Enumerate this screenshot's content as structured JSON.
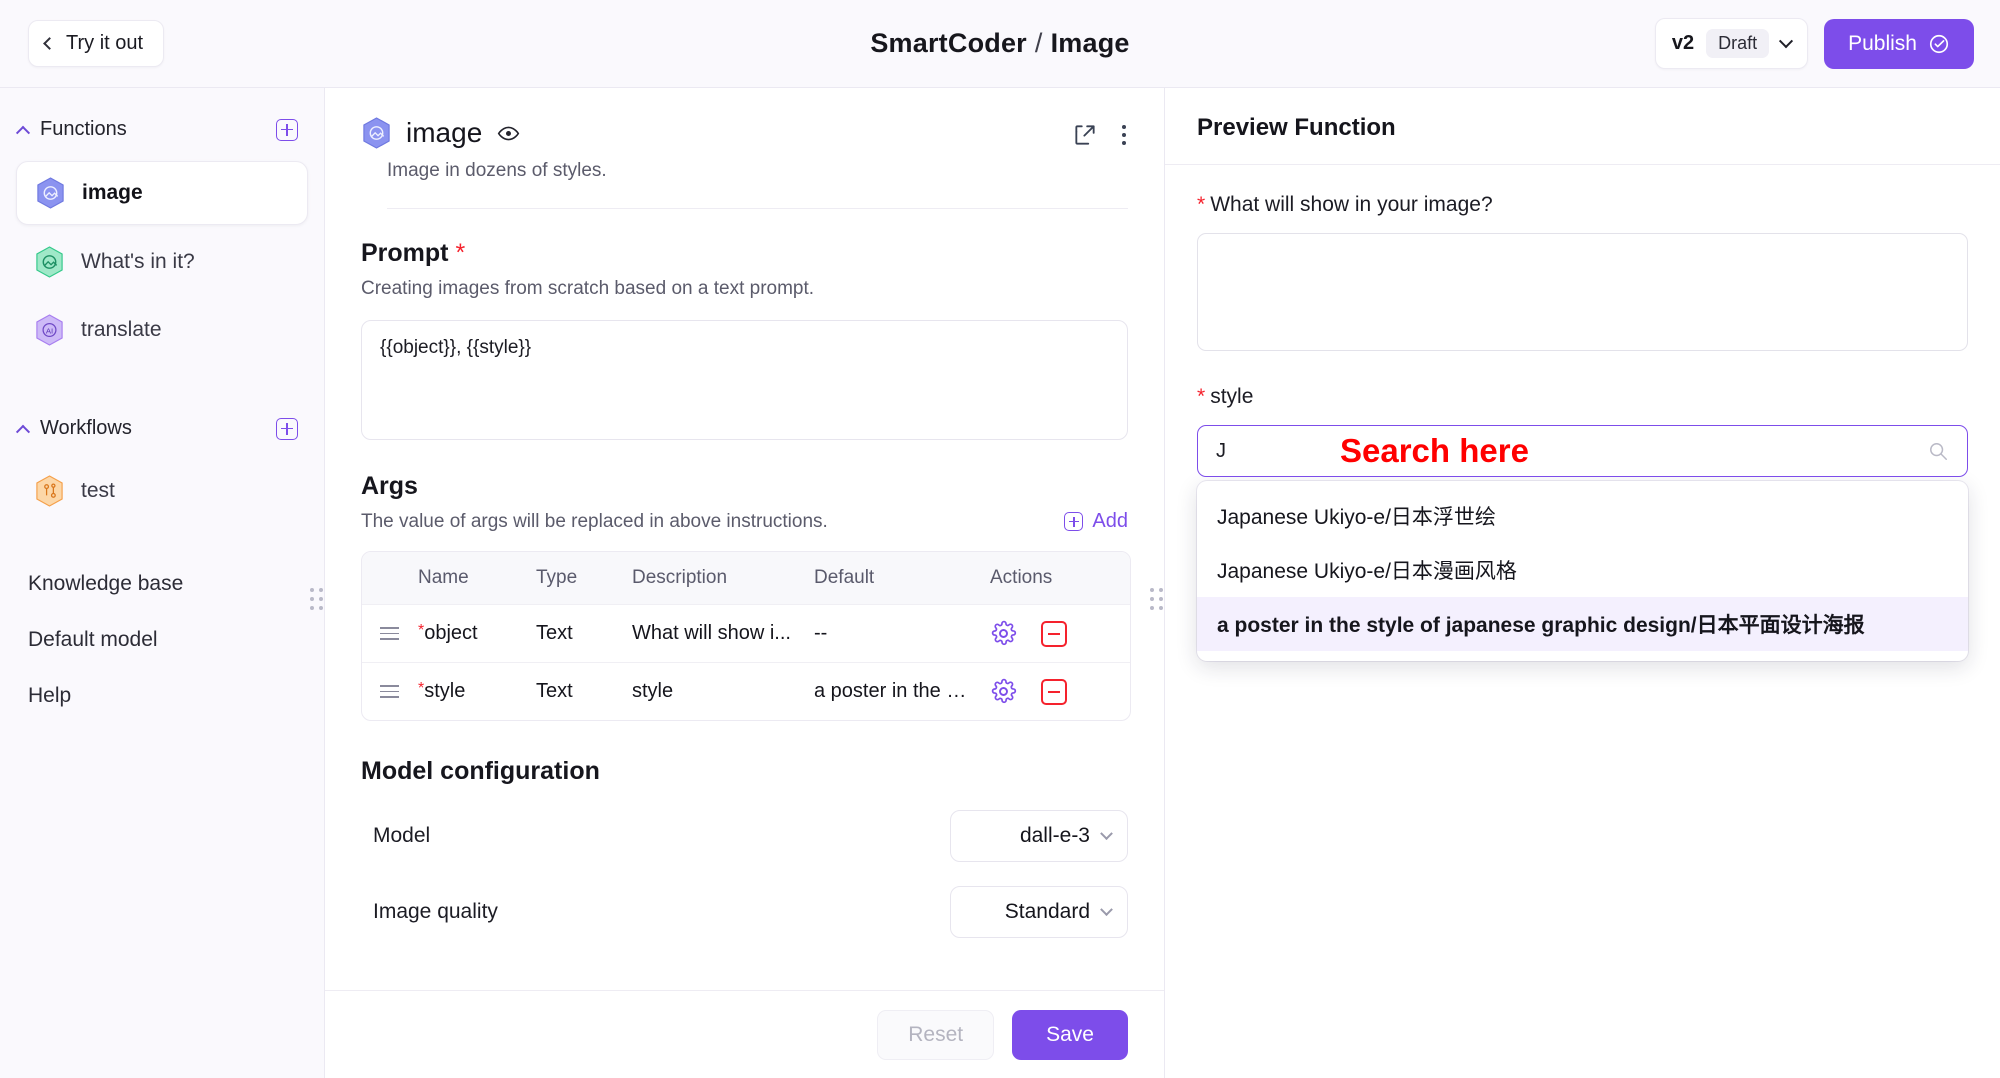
{
  "topbar": {
    "back_label": "Try it out",
    "back_icon": "chevron-left-icon",
    "app_name": "SmartCoder",
    "separator": "/",
    "page_name": "Image",
    "version": "v2",
    "version_status": "Draft",
    "version_caret_icon": "chevron-down-icon",
    "publish_label": "Publish",
    "publish_icon": "check-circle-icon",
    "accent_color": "#7d4dea"
  },
  "sidebar": {
    "sections": [
      {
        "label": "Functions",
        "collapse_icon": "chevron-up-icon",
        "add_icon": "plus-square-icon",
        "items": [
          {
            "label": "image",
            "icon": "hexagon-image-icon",
            "icon_color": "#6f7fe8",
            "active": true
          },
          {
            "label": "What's in it?",
            "icon": "hexagon-image-icon",
            "icon_color": "#34c98a",
            "active": false
          },
          {
            "label": "translate",
            "icon": "hexagon-ai-icon",
            "icon_color": "#a87ef0",
            "active": false
          }
        ]
      },
      {
        "label": "Workflows",
        "collapse_icon": "chevron-up-icon",
        "add_icon": "plus-square-icon",
        "items": [
          {
            "label": "test",
            "icon": "hexagon-workflow-icon",
            "icon_color": "#f5a04a",
            "active": false
          }
        ]
      }
    ],
    "links": [
      {
        "label": "Knowledge base"
      },
      {
        "label": "Default model"
      },
      {
        "label": "Help"
      }
    ]
  },
  "main": {
    "function": {
      "name": "image",
      "visibility_icon": "eye-icon",
      "edit_icon": "edit-square-icon",
      "more_icon": "more-vertical-icon",
      "description": "Image in dozens of styles."
    },
    "prompt": {
      "title": "Prompt",
      "required_mark": "*",
      "subtitle": "Creating images from scratch based on a text prompt.",
      "value": "{{object}}, {{style}}"
    },
    "args": {
      "title": "Args",
      "subtitle": "The value of args will be replaced in above instructions.",
      "add_label": "Add",
      "add_icon": "plus-square-icon",
      "columns": [
        "",
        "Name",
        "Type",
        "Description",
        "Default",
        "Actions"
      ],
      "rows": [
        {
          "drag_icon": "drag-handle-icon",
          "required_mark": "*",
          "name": "object",
          "type": "Text",
          "description": "What will show i...",
          "default": "--",
          "settings_icon": "gear-icon",
          "remove_icon": "minus-square-icon"
        },
        {
          "drag_icon": "drag-handle-icon",
          "required_mark": "*",
          "name": "style",
          "type": "Text",
          "description": "style",
          "default": "a poster in the s...",
          "settings_icon": "gear-icon",
          "remove_icon": "minus-square-icon"
        }
      ]
    },
    "model_config": {
      "title": "Model configuration",
      "rows": [
        {
          "label": "Model",
          "value": "dall-e-3",
          "caret_icon": "chevron-down-icon"
        },
        {
          "label": "Image quality",
          "value": "Standard",
          "caret_icon": "chevron-down-icon"
        }
      ]
    },
    "footer": {
      "reset_label": "Reset",
      "save_label": "Save"
    }
  },
  "preview": {
    "title": "Preview Function",
    "object_field": {
      "required_mark": "*",
      "label": "What will show in your image?",
      "value": ""
    },
    "style_field": {
      "required_mark": "*",
      "label": "style",
      "value": "J",
      "search_icon": "search-icon",
      "annotation": "Search here",
      "annotation_color": "#ff0000",
      "options": [
        {
          "label": "Japanese Ukiyo-e/日本浮世绘",
          "selected": false
        },
        {
          "label": "Japanese Ukiyo-e/日本漫画风格",
          "selected": false
        },
        {
          "label": "a poster in the style of japanese graphic design/日本平面设计海报",
          "selected": true
        }
      ]
    }
  }
}
